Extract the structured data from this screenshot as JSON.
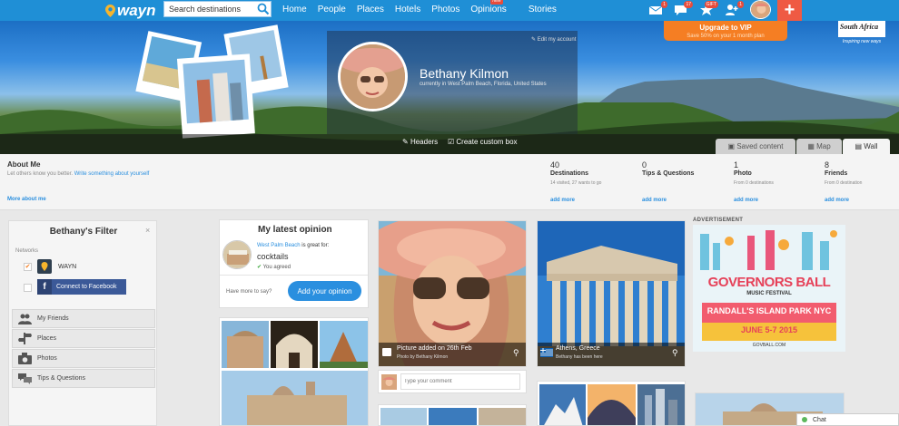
{
  "topbar": {
    "logo": "wayn",
    "search_placeholder": "Search destinations",
    "nav": [
      "Home",
      "People",
      "Places",
      "Hotels",
      "Photos",
      "Opinions",
      "Stories"
    ],
    "opinions_badge": "new",
    "badges": {
      "messages": "1",
      "notifications": "17",
      "gift": "GIFT",
      "friends": "1"
    },
    "brand_color": "#1f8fd6"
  },
  "cover": {
    "edit_label": "Edit my account",
    "name": "Bethany Kilmon",
    "location": "currently in West Palm Beach, Florida, United States",
    "vip_title": "Upgrade to VIP",
    "vip_sub": "Save 50% on your 1 month plan",
    "sponsor": "South Africa",
    "sponsor_tagline": "Inspiring new ways",
    "headers_label": "Headers",
    "custom_box_label": "Create custom box",
    "tabs": [
      "Saved content",
      "Map",
      "Wall"
    ]
  },
  "about": {
    "title": "About Me",
    "prompt": "Let others know you better.",
    "write_link": "Write something about yourself",
    "more_link": "More about me"
  },
  "stats": [
    {
      "number": "40",
      "label": "Destinations",
      "sub": "14 visited, 27 wants to go",
      "link": "add more"
    },
    {
      "number": "0",
      "label": "Tips & Questions",
      "sub": "",
      "link": "add more"
    },
    {
      "number": "1",
      "label": "Photo",
      "sub": "From 0 destinations",
      "link": "add more"
    },
    {
      "number": "8",
      "label": "Friends",
      "sub": "From 0 destination",
      "link": "add more"
    }
  ],
  "filter": {
    "title": "Bethany's Filter",
    "close": "×",
    "networks_label": "Networks",
    "wayn_label": "WAYN",
    "facebook_label": "Connect to Facebook",
    "items": [
      "My Friends",
      "Places",
      "Photos",
      "Tips & Questions"
    ]
  },
  "opinion": {
    "title": "My latest opinion",
    "place": "West Palm Beach",
    "great_for": " is great for:",
    "tag": "cocktails",
    "agreed": "You agreed",
    "prompt": "Have more to say?",
    "button": "Add your opinion"
  },
  "photo_post": {
    "caption": "Picture added on 26th Feb",
    "by": "Photo by Bethany Kilmon",
    "comment_placeholder": "Type your comment"
  },
  "place_post": {
    "caption": "Athens, Greece",
    "by": "Bethany has been here"
  },
  "ad": {
    "label": "ADVERTISEMENT",
    "line1": "GOVERNORS BALL",
    "line2": "MUSIC FESTIVAL",
    "line3": "RANDALL'S ISLAND PARK",
    "line4": "NYC",
    "line5": "JUNE 5-7 2015",
    "url": "GOVBALL.COM"
  },
  "chat": {
    "label": "Chat"
  }
}
